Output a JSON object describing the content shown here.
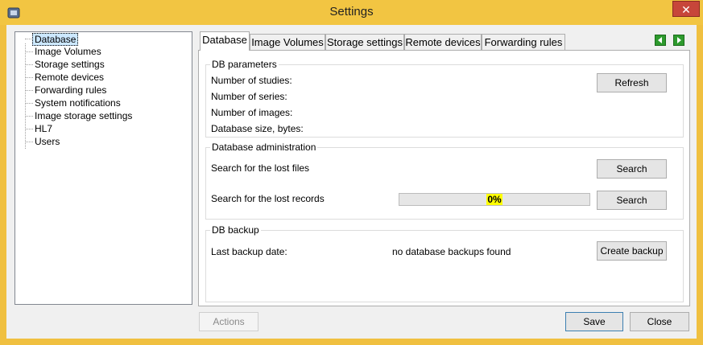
{
  "window": {
    "title": "Settings",
    "close_label": "✕"
  },
  "tree": {
    "items": [
      {
        "label": "Database",
        "selected": true
      },
      {
        "label": "Image Volumes"
      },
      {
        "label": "Storage settings"
      },
      {
        "label": "Remote devices"
      },
      {
        "label": "Forwarding rules"
      },
      {
        "label": "System notifications"
      },
      {
        "label": "Image storage settings"
      },
      {
        "label": "HL7"
      },
      {
        "label": "Users"
      }
    ]
  },
  "tabs": [
    {
      "label": "Database",
      "active": true
    },
    {
      "label": "Image Volumes"
    },
    {
      "label": "Storage settings"
    },
    {
      "label": "Remote devices"
    },
    {
      "label": "Forwarding rules"
    }
  ],
  "db_parameters": {
    "title": "DB parameters",
    "studies_label": "Number of studies:",
    "series_label": "Number of series:",
    "images_label": "Number of images:",
    "size_label": "Database size, bytes:",
    "refresh_label": "Refresh"
  },
  "db_admin": {
    "title": "Database administration",
    "lost_files_label": "Search for the lost files",
    "lost_records_label": "Search for the lost records",
    "progress_text": "0%",
    "progress_value": 0,
    "search_files_label": "Search",
    "search_records_label": "Search"
  },
  "db_backup": {
    "title": "DB backup",
    "last_backup_label": "Last backup date:",
    "last_backup_value": "no database backups found",
    "create_backup_label": "Create backup"
  },
  "footer": {
    "actions_label": "Actions",
    "save_label": "Save",
    "close_label": "Close"
  },
  "colors": {
    "titlebar": "#f2c542",
    "progress_text_bg": "#ffff00",
    "nav_arrow": "#2d9a2d"
  }
}
